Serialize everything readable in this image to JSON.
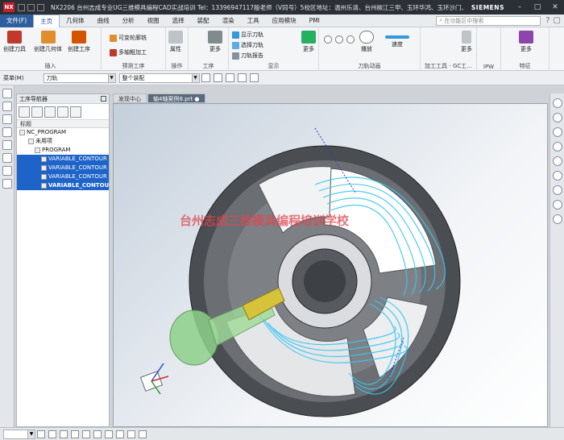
{
  "titlebar": {
    "logo": "NX",
    "title": "NX2206 台州志成专业UG三维模具编程CAD实战培训  Tel：13396947117殷老师（V同号）5校区地址：温州乐清、台州椒江三甲、玉环华鸿、玉环沙门、玉环坎门 - 加工",
    "brand": "SIEMENS"
  },
  "menubar": {
    "items": [
      "文件(F)",
      "主页",
      "几何体",
      "曲线",
      "分析",
      "视图",
      "选择",
      "装配",
      "渲染",
      "工具",
      "应用模块",
      "PMI"
    ],
    "active_index": 1,
    "search_placeholder": "在功能区中搜索"
  },
  "ribbon": {
    "groups": [
      {
        "label": "插入",
        "buttons": [
          "创建刀具",
          "创建几何体",
          "创建工序"
        ]
      },
      {
        "label": "预测工序",
        "buttons": [
          "可变轮廓铣",
          "多轴粗加工"
        ]
      },
      {
        "label": "操作",
        "buttons": [
          "属性"
        ]
      },
      {
        "label": "工序",
        "buttons": [
          "更多"
        ]
      },
      {
        "label": "显示",
        "buttons": [
          "显示刀轨",
          "选择刀轨",
          "刀轨报告",
          "更多"
        ]
      },
      {
        "label": "刀轨动画",
        "buttons": [
          "播放",
          "速度"
        ]
      },
      {
        "label": "加工工具 - GC工...",
        "buttons": [
          "更多"
        ]
      },
      {
        "label": "IPW",
        "buttons": []
      },
      {
        "label": "特征",
        "buttons": [
          "更多"
        ]
      }
    ]
  },
  "toolbar2": {
    "menu_label": "菜单(M)",
    "filter_value": "刀轨",
    "assembly_value": "整个装配"
  },
  "navigator": {
    "title": "工序导航器",
    "column": "标题",
    "items": [
      {
        "label": "NC_PROGRAM",
        "selected": false,
        "bold": false
      },
      {
        "label": "未用项",
        "selected": false,
        "bold": false
      },
      {
        "label": "PROGRAM",
        "selected": false,
        "bold": false
      },
      {
        "label": "VARIABLE_CONTOUR",
        "selected": true,
        "bold": false
      },
      {
        "label": "VARIABLE_CONTOUR",
        "selected": true,
        "bold": false
      },
      {
        "label": "VARIABLE_CONTOUR",
        "selected": true,
        "bold": false
      },
      {
        "label": "VARIABLE_CONTOUR",
        "selected": true,
        "bold": true
      }
    ]
  },
  "tabs": [
    {
      "label": "发现中心",
      "active": false
    },
    {
      "label": "轴4轴案例8.prt ●",
      "active": true
    }
  ],
  "viewport": {
    "watermark": "台州志成三维模具编程培训学校",
    "axis_labels": [
      "Z",
      "Y",
      "X"
    ]
  },
  "colors": {
    "file_menu_bg": "#2f5e9e",
    "selection": "#1e64c8",
    "toolpath": "#3cc6f0",
    "watermark": "#e0464f"
  }
}
